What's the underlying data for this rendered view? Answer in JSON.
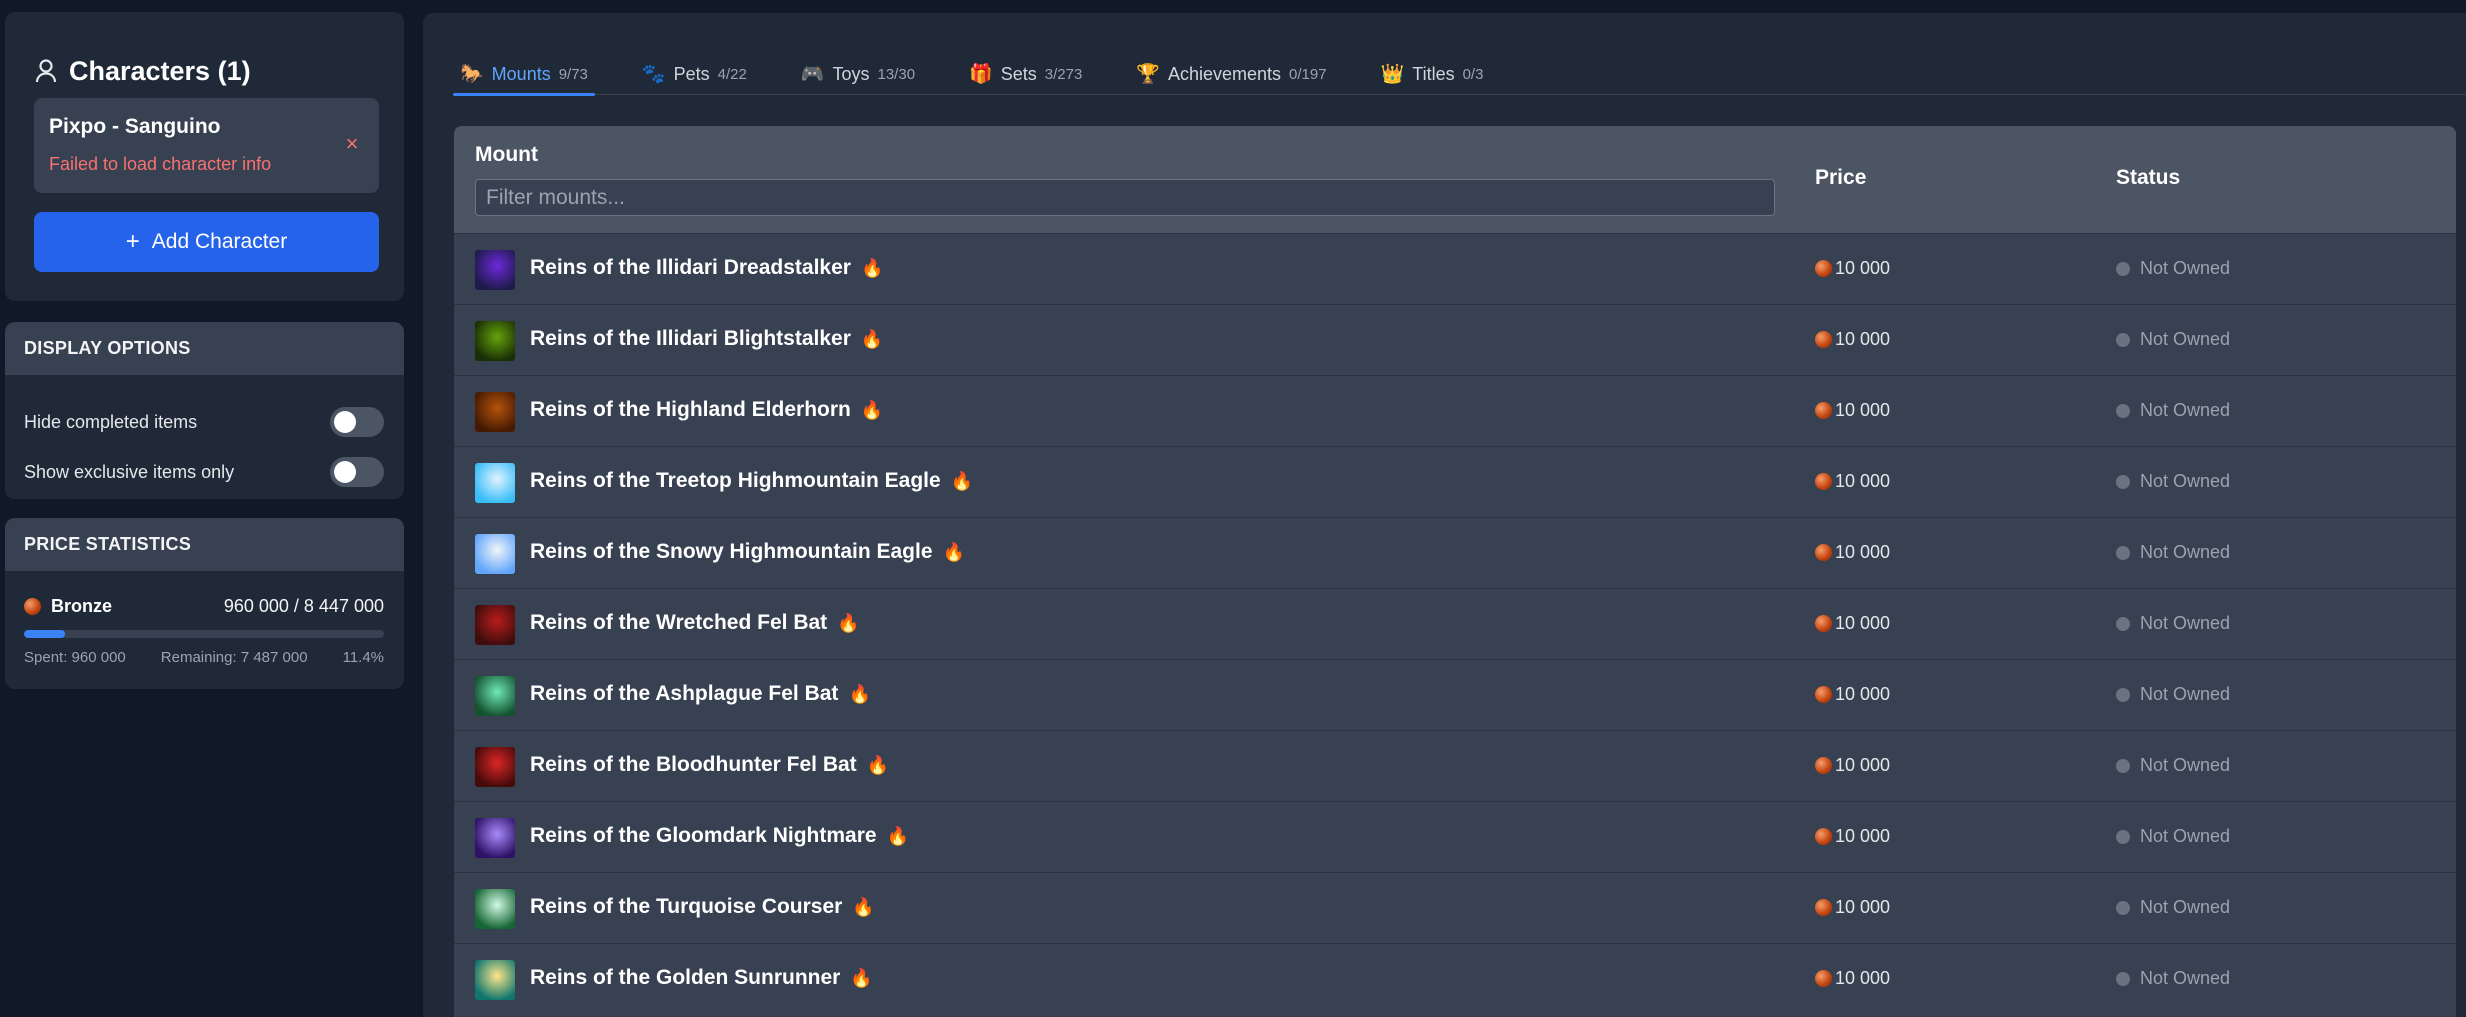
{
  "sidebar": {
    "characters": {
      "title": "Characters (1)",
      "card": {
        "name": "Pixpo - Sanguino",
        "error": "Failed to load character info",
        "close_icon": "×"
      },
      "add_button": "Add Character"
    },
    "display_options": {
      "title": "DISPLAY OPTIONS",
      "options": [
        {
          "label": "Hide completed items",
          "enabled": false
        },
        {
          "label": "Show exclusive items only",
          "enabled": false
        }
      ]
    },
    "price_statistics": {
      "title": "PRICE STATISTICS",
      "currency": "Bronze",
      "value": "960 000 / 8 447 000",
      "progress_fraction": 0.114,
      "spent": "Spent: 960 000",
      "remaining": "Remaining: 7 487 000",
      "percent": "11.4%"
    }
  },
  "tabs": [
    {
      "icon": "🐎",
      "icon_name": "horse-icon",
      "label": "Mounts",
      "count": "9/73",
      "active": true
    },
    {
      "icon": "🐾",
      "icon_name": "paw-icon",
      "label": "Pets",
      "count": "4/22",
      "active": false
    },
    {
      "icon": "🎮",
      "icon_name": "gamepad-icon",
      "label": "Toys",
      "count": "13/30",
      "active": false
    },
    {
      "icon": "🎁",
      "icon_name": "gift-icon",
      "label": "Sets",
      "count": "3/273",
      "active": false
    },
    {
      "icon": "🏆",
      "icon_name": "trophy-icon",
      "label": "Achievements",
      "count": "0/197",
      "active": false
    },
    {
      "icon": "👑",
      "icon_name": "crown-icon",
      "label": "Titles",
      "count": "0/3",
      "active": false
    }
  ],
  "table": {
    "headers": {
      "mount": "Mount",
      "price": "Price",
      "status": "Status"
    },
    "filter_placeholder": "Filter mounts...",
    "rows": [
      {
        "name": "Reins of the Illidari Dreadstalker",
        "price": "10 000",
        "status": "Not Owned",
        "thumb": [
          "#6d28d9",
          "#1e1b4b"
        ]
      },
      {
        "name": "Reins of the Illidari Blightstalker",
        "price": "10 000",
        "status": "Not Owned",
        "thumb": [
          "#65a30d",
          "#1a2e05"
        ]
      },
      {
        "name": "Reins of the Highland Elderhorn",
        "price": "10 000",
        "status": "Not Owned",
        "thumb": [
          "#b45309",
          "#451a03"
        ]
      },
      {
        "name": "Reins of the Treetop Highmountain Eagle",
        "price": "10 000",
        "status": "Not Owned",
        "thumb": [
          "#e0f2fe",
          "#38bdf8"
        ]
      },
      {
        "name": "Reins of the Snowy Highmountain Eagle",
        "price": "10 000",
        "status": "Not Owned",
        "thumb": [
          "#f1f5f9",
          "#60a5fa"
        ]
      },
      {
        "name": "Reins of the Wretched Fel Bat",
        "price": "10 000",
        "status": "Not Owned",
        "thumb": [
          "#b91c1c",
          "#3f0d0d"
        ]
      },
      {
        "name": "Reins of the Ashplague Fel Bat",
        "price": "10 000",
        "status": "Not Owned",
        "thumb": [
          "#6ee7b7",
          "#14532d"
        ]
      },
      {
        "name": "Reins of the Bloodhunter Fel Bat",
        "price": "10 000",
        "status": "Not Owned",
        "thumb": [
          "#dc2626",
          "#450a0a"
        ]
      },
      {
        "name": "Reins of the Gloomdark Nightmare",
        "price": "10 000",
        "status": "Not Owned",
        "thumb": [
          "#a78bfa",
          "#2e1065"
        ]
      },
      {
        "name": "Reins of the Turquoise Courser",
        "price": "10 000",
        "status": "Not Owned",
        "thumb": [
          "#d1fae5",
          "#166534"
        ]
      },
      {
        "name": "Reins of the Golden Sunrunner",
        "price": "10 000",
        "status": "Not Owned",
        "thumb": [
          "#fde68a",
          "#0f766e"
        ]
      }
    ]
  },
  "colors": {
    "accent": "#3b82f6",
    "error": "#f87171",
    "bronze": "#c2410c"
  }
}
